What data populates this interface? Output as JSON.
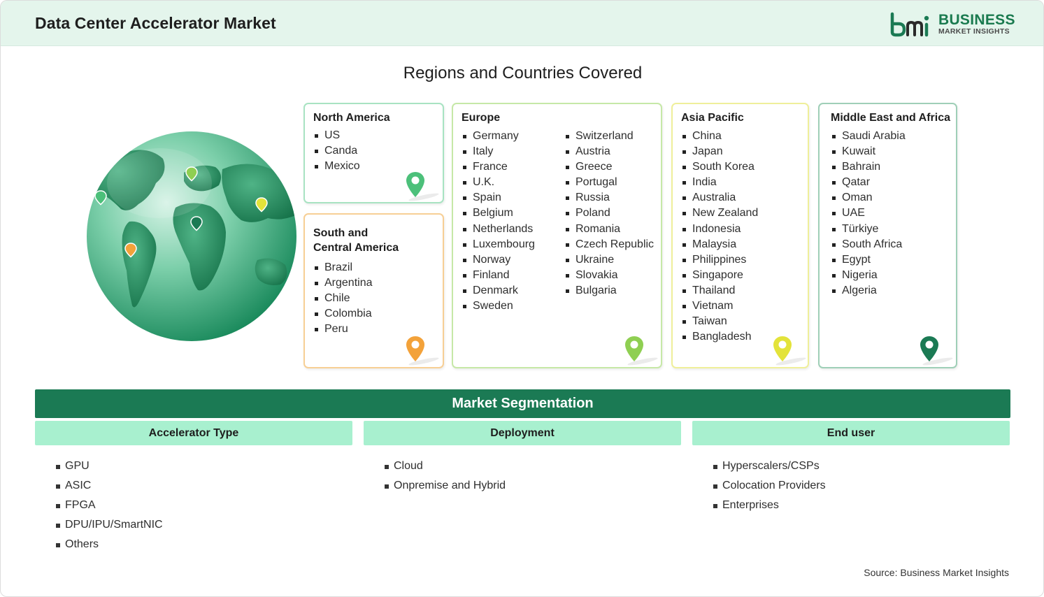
{
  "header": {
    "title": "Data Center Accelerator Market",
    "logo_line1": "BUSINESS",
    "logo_line2": "MARKET INSIGHTS"
  },
  "regions": {
    "title": "Regions and Countries Covered",
    "north_america": {
      "title": "North America",
      "countries": [
        "US",
        "Canda",
        "Mexico"
      ],
      "color": "#4cc07a"
    },
    "south_central_america": {
      "title_line1": "South and",
      "title_line2": "Central America",
      "countries": [
        "Brazil",
        "Argentina",
        "Chile",
        "Colombia",
        "Peru"
      ],
      "color": "#f3a23a"
    },
    "europe": {
      "title": "Europe",
      "countries_col1": [
        "Germany",
        "Italy",
        "France",
        "U.K.",
        "Spain",
        "Belgium",
        "Netherlands",
        "Luxembourg",
        "Norway",
        "Finland",
        "Denmark",
        "Sweden"
      ],
      "countries_col2": [
        "Switzerland",
        "Austria",
        "Greece",
        "Portugal",
        "Russia",
        "Poland",
        "Romania",
        "Czech Republic",
        "Ukraine",
        "Slovakia",
        "Bulgaria"
      ],
      "color": "#8fcf52"
    },
    "asia_pacific": {
      "title": "Asia Pacific",
      "countries": [
        "China",
        "Japan",
        "South Korea",
        "India",
        "Australia",
        "New Zealand",
        "Indonesia",
        "Malaysia",
        "Philippines",
        "Singapore",
        "Thailand",
        "Vietnam",
        "Taiwan",
        "Bangladesh"
      ],
      "color": "#e3e33a"
    },
    "middle_east_africa": {
      "title": "Middle East and Africa",
      "countries": [
        "Saudi Arabia",
        "Kuwait",
        "Bahrain",
        "Qatar",
        "Oman",
        "UAE",
        "Türkiye",
        "South Africa",
        "Egypt",
        "Nigeria",
        "Algeria"
      ],
      "color": "#1b7a54"
    }
  },
  "segmentation": {
    "title": "Market Segmentation",
    "columns": [
      {
        "title": "Accelerator Type",
        "items": [
          "GPU",
          "ASIC",
          "FPGA",
          "DPU/IPU/SmartNIC",
          "Others"
        ]
      },
      {
        "title": "Deployment",
        "items": [
          "Cloud",
          "Onpremise and Hybrid"
        ]
      },
      {
        "title": "End user",
        "items": [
          "Hyperscalers/CSPs",
          "Colocation Providers",
          "Enterprises"
        ]
      }
    ]
  },
  "source": "Source: Business Market Insights",
  "colors": {
    "accent_dark": "#1b7a54",
    "accent_light": "#a8f0cf",
    "header_bg": "#e4f5ec"
  }
}
